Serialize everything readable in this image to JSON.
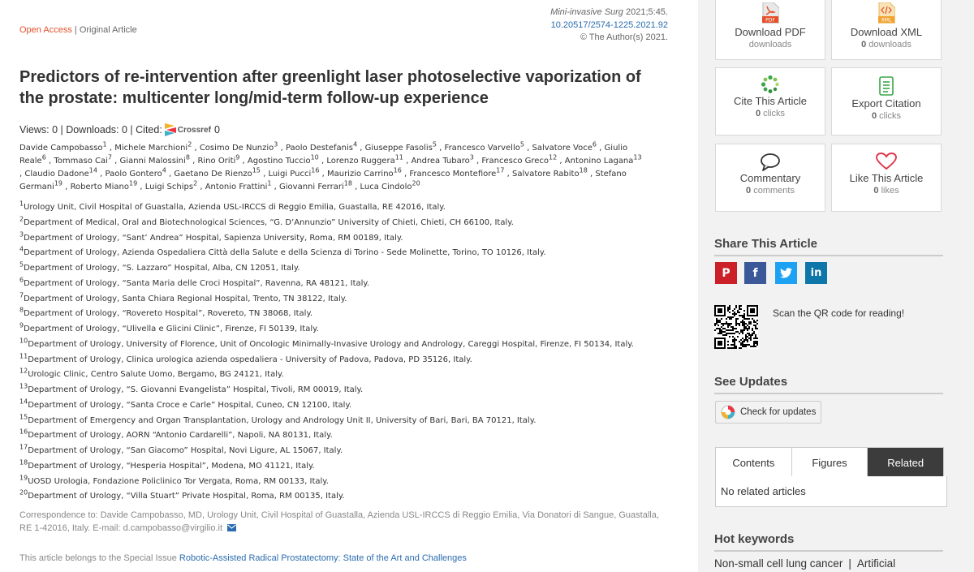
{
  "header": {
    "access": "Open Access",
    "separator": " | ",
    "article_type": "Original Article",
    "journal_name": "Mini-invasive Surg",
    "journal_citation": " 2021;5:45.",
    "doi": "10.20517/2574-1225.2021.92",
    "copyright": "© The Author(s) 2021."
  },
  "article": {
    "title": "Predictors of re-intervention after greenlight laser photoselective vaporization of the prostate: multicenter long/mid-term follow-up experience",
    "metrics_prefix": "Views: 0 | Downloads: 0 | Cited: ",
    "crossref_label": "Crossref",
    "crossref_count": "0"
  },
  "authors": [
    {
      "name": "Davide Campobasso",
      "sup": "1"
    },
    {
      "name": "Michele Marchioni",
      "sup": "2"
    },
    {
      "name": "Cosimo De Nunzio",
      "sup": "3"
    },
    {
      "name": "Paolo Destefanis",
      "sup": "4"
    },
    {
      "name": "Giuseppe Fasolis",
      "sup": "5"
    },
    {
      "name": "Francesco Varvello",
      "sup": "5"
    },
    {
      "name": "Salvatore Voce",
      "sup": "6"
    },
    {
      "name": "Giulio Reale",
      "sup": "6"
    },
    {
      "name": "Tommaso Cai",
      "sup": "7"
    },
    {
      "name": "Gianni Malossini",
      "sup": "8"
    },
    {
      "name": "Rino Oriti",
      "sup": "9"
    },
    {
      "name": "Agostino Tuccio",
      "sup": "10"
    },
    {
      "name": "Lorenzo Ruggera",
      "sup": "11"
    },
    {
      "name": "Andrea Tubaro",
      "sup": "3"
    },
    {
      "name": "Francesco Greco",
      "sup": "12"
    },
    {
      "name": "Antonino Lagana",
      "sup": "13"
    },
    {
      "name": "Claudio Dadone",
      "sup": "14"
    },
    {
      "name": "Paolo Gontero",
      "sup": "4"
    },
    {
      "name": "Gaetano De Rienzo",
      "sup": "15"
    },
    {
      "name": "Luigi Pucci",
      "sup": "16"
    },
    {
      "name": "Maurizio Carrino",
      "sup": "16"
    },
    {
      "name": "Francesco Montefiore",
      "sup": "17"
    },
    {
      "name": "Salvatore Rabito",
      "sup": "18"
    },
    {
      "name": "Stefano Germani",
      "sup": "19"
    },
    {
      "name": "Roberto Miano",
      "sup": "19"
    },
    {
      "name": "Luigi Schips",
      "sup": "2"
    },
    {
      "name": "Antonio Frattini",
      "sup": "1"
    },
    {
      "name": "Giovanni Ferrari",
      "sup": "18"
    },
    {
      "name": "Luca Cindolo",
      "sup": "20"
    }
  ],
  "affiliations": [
    {
      "num": "1",
      "text": "Urology Unit, Civil Hospital of Guastalla, Azienda USL-IRCCS di Reggio Emilia, Guastalla, RE 42016, Italy."
    },
    {
      "num": "2",
      "text": "Department of Medical, Oral and Biotechnological Sciences, “G. D’Annunzio” University of Chieti, Chieti, CH 66100, Italy."
    },
    {
      "num": "3",
      "text": "Department of Urology, “Sant’ Andrea” Hospital, Sapienza University, Roma, RM 00189, Italy."
    },
    {
      "num": "4",
      "text": "Department of Urology, Azienda Ospedaliera Città della Salute e della Scienza di Torino - Sede Molinette, Torino, TO 10126, Italy."
    },
    {
      "num": "5",
      "text": "Department of Urology, “S. Lazzaro” Hospital, Alba, CN 12051, Italy."
    },
    {
      "num": "6",
      "text": "Department of Urology, “Santa Maria delle Croci Hospital”, Ravenna, RA 48121, Italy."
    },
    {
      "num": "7",
      "text": "Department of Urology, Santa Chiara Regional Hospital, Trento, TN 38122, Italy."
    },
    {
      "num": "8",
      "text": "Department of Urology, “Rovereto Hospital”, Rovereto, TN 38068, Italy."
    },
    {
      "num": "9",
      "text": "Department of Urology, “Ulivella e Glicini Clinic”, Firenze, FI 50139, Italy."
    },
    {
      "num": "10",
      "text": "Department of Urology, University of Florence, Unit of Oncologic Minimally-Invasive Urology and Andrology, Careggi Hospital, Firenze, FI 50134, Italy."
    },
    {
      "num": "11",
      "text": "Department of Urology, Clinica urologica azienda ospedaliera - University of Padova, Padova, PD 35126, Italy."
    },
    {
      "num": "12",
      "text": "Urologic Clinic, Centro Salute Uomo, Bergamo, BG 24121, Italy."
    },
    {
      "num": "13",
      "text": "Department of Urology, “S. Giovanni Evangelista” Hospital, Tivoli, RM 00019, Italy."
    },
    {
      "num": "14",
      "text": "Department of Urology, “Santa Croce e Carle” Hospital, Cuneo, CN 12100, Italy."
    },
    {
      "num": "15",
      "text": "Department of Emergency and Organ Transplantation, Urology and Andrology Unit II, University of Bari, Bari, BA 70121, Italy."
    },
    {
      "num": "16",
      "text": "Department of Urology, AORN “Antonio Cardarelli”, Napoli, NA 80131, Italy."
    },
    {
      "num": "17",
      "text": "Department of Urology, “San Giacomo” Hospital, Novi Ligure, AL 15067, Italy."
    },
    {
      "num": "18",
      "text": "Department of Urology, “Hesperia Hospital”, Modena, MO 41121, Italy."
    },
    {
      "num": "19",
      "text": "UOSD Urologia, Fondazione Policlinico Tor Vergata, Roma, RM 00133, Italy."
    },
    {
      "num": "20",
      "text": "Department of Urology, “Villa Stuart” Private Hospital, Roma, RM 00135, Italy."
    }
  ],
  "correspondence": "Correspondence to: Davide Campobasso, MD, Urology Unit, Civil Hospital of Guastalla, Azienda USL-IRCCS di Reggio Emilia, Via Donatori di Sangue, Guastalla, RE 1-42016, Italy. E-mail: d.campobasso@virgilio.it",
  "special_issue": {
    "prefix": "This article belongs to the Special Issue ",
    "link": "Robotic-Assisted Radical Prostatectomy: State of the Art and Challenges"
  },
  "sidebar": {
    "download_pdf": {
      "label": "Download PDF",
      "sub": "downloads",
      "icon": "pdf-icon",
      "icon_text": "PDF"
    },
    "download_xml": {
      "label": "Download XML",
      "count": "0",
      "sub": " downloads",
      "icon": "xml-icon",
      "icon_text": "XML"
    },
    "cite": {
      "label": "Cite This Article",
      "count": "0",
      "sub": " clicks"
    },
    "export": {
      "label": "Export Citation",
      "count": "0",
      "sub": " clicks"
    },
    "commentary": {
      "label": "Commentary",
      "count": "0",
      "sub": " comments"
    },
    "like": {
      "label": "Like This Article",
      "count": "0",
      "sub": " likes"
    },
    "share_title": "Share This Article",
    "share": [
      {
        "name": "pinterest",
        "glyph": "P",
        "color": "#cb2027"
      },
      {
        "name": "facebook",
        "glyph": "f",
        "color": "#3b5998"
      },
      {
        "name": "twitter",
        "glyph": "t",
        "color": "#1da1f2"
      },
      {
        "name": "linkedin",
        "glyph": "in",
        "color": "#0e76a8"
      }
    ],
    "qr_text": "Scan the QR code for reading!",
    "updates_title": "See Updates",
    "check_updates": "Check for updates",
    "tabs": [
      "Contents",
      "Figures",
      "Related"
    ],
    "active_tab": "Related",
    "tab_content": "No related articles",
    "hot_title": "Hot keywords",
    "keywords": [
      "Non-small cell lung cancer",
      "Artificial"
    ]
  },
  "colors": {
    "accent_orange": "#e4512b",
    "link_blue": "#2b6cb0",
    "sidebar_bg": "#f2f2f2",
    "heart_red": "#e0344a",
    "cite_green": "#3aa648"
  }
}
